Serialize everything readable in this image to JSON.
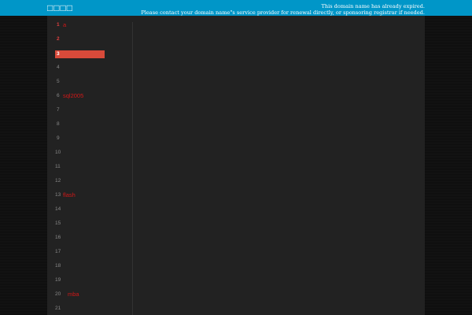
{
  "header": {
    "logo": "□□□□",
    "notice_line1": "This domain name has already expired.",
    "notice_line2": "Please contact your domain name\"s service provider for renewal directly, or sponsoring registrar if needed."
  },
  "list": [
    {
      "n": "1",
      "label": "a",
      "red": true
    },
    {
      "n": "2",
      "label": "",
      "red": true
    },
    {
      "n": "3",
      "label": "",
      "highlight": true
    },
    {
      "n": "4",
      "label": ""
    },
    {
      "n": "5",
      "label": ""
    },
    {
      "n": "6",
      "label": "sql2005"
    },
    {
      "n": "7",
      "label": ""
    },
    {
      "n": "8",
      "label": ""
    },
    {
      "n": "9",
      "label": ""
    },
    {
      "n": "10",
      "label": ""
    },
    {
      "n": "11",
      "label": ""
    },
    {
      "n": "12",
      "label": ""
    },
    {
      "n": "13",
      "label": "flash"
    },
    {
      "n": "14",
      "label": ""
    },
    {
      "n": "15",
      "label": ""
    },
    {
      "n": "16",
      "label": ""
    },
    {
      "n": "17",
      "label": ""
    },
    {
      "n": "18",
      "label": ""
    },
    {
      "n": "19",
      "label": ""
    },
    {
      "n": "20",
      "label": "mba",
      "indent": true
    },
    {
      "n": "21",
      "label": ""
    }
  ],
  "colors": {
    "header": "#0096c8",
    "highlight": "#d84a3a",
    "link": "#d01818"
  }
}
